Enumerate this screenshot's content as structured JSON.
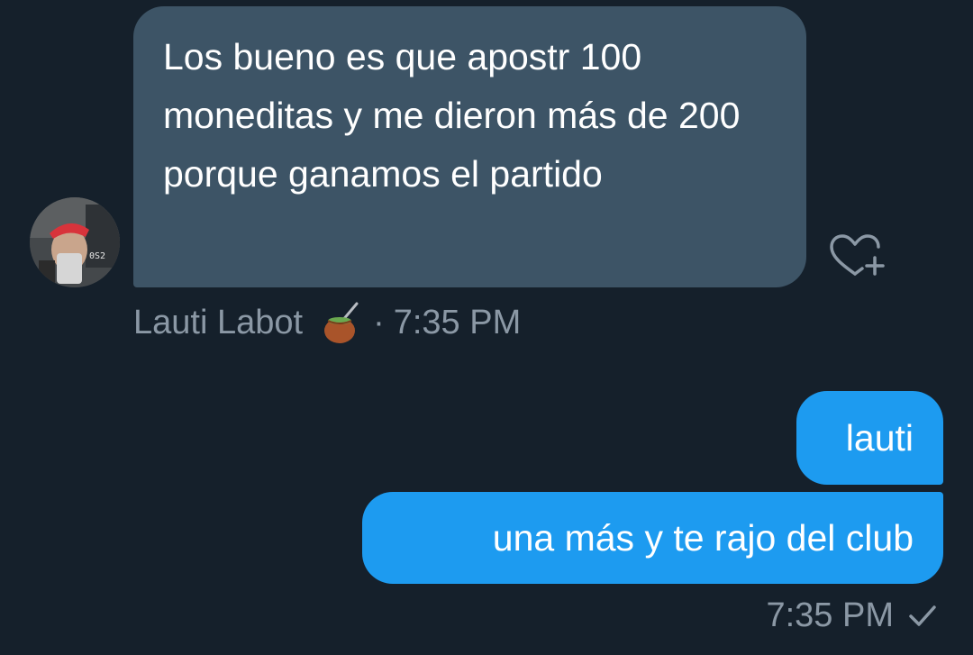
{
  "conversation": {
    "incoming": {
      "sender_name": "Lauti Labot",
      "sender_emoji_icon": "mate-icon",
      "message_text": "Los bueno es que apostr 100 moneditas y me dieron más de 200 porque ganamos el partido",
      "separator": "·",
      "time": "7:35 PM",
      "reaction_icon": "heart-plus-icon"
    },
    "outgoing": {
      "messages": [
        {
          "text": "lauti"
        },
        {
          "text": "una más y te rajo del club"
        }
      ],
      "time": "7:35 PM",
      "status_icon": "checkmark-icon"
    }
  },
  "colors": {
    "background": "#15202b",
    "incoming_bubble": "#3d5466",
    "outgoing_bubble": "#1d9bf0",
    "text": "#ffffff",
    "meta_text": "#8b98a5"
  }
}
